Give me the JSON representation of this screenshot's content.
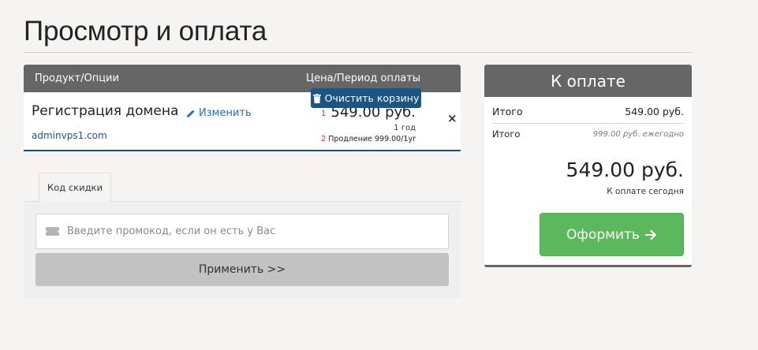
{
  "page": {
    "title": "Просмотр и оплата"
  },
  "cart": {
    "header": {
      "product": "Продукт/Опции",
      "price": "Цена/Период оплаты"
    },
    "item": {
      "name": "Регистрация домена",
      "edit": "Изменить",
      "domain": "adminvps1.com",
      "price": "549.00 руб.",
      "cycle": "1 год",
      "renewal": "Продление 999.00/1yr",
      "marker1": "1",
      "marker2": "2",
      "remove": "×"
    },
    "clear_label": "Очистить корзину"
  },
  "promo": {
    "tab_label": "Код скидки",
    "placeholder": "Введите промокод, если он есть у Вас",
    "apply_label": "Применить >>"
  },
  "summary": {
    "title": "К оплате",
    "subtotal_label": "Итого",
    "subtotal_value": "549.00 руб.",
    "recurring_label": "Итого",
    "recurring_value": "999.00 руб. ежегодно",
    "total": "549.00 руб.",
    "total_caption": "К оплате сегодня",
    "checkout_label": "Оформить"
  },
  "colors": {
    "header_bg": "#666666",
    "accent_blue": "#1a5585",
    "checkout_green": "#5cb85c",
    "marker_red": "#e0331c"
  },
  "icons": [
    "pencil-icon",
    "trash-icon",
    "ticket-icon",
    "arrow-right-icon"
  ]
}
